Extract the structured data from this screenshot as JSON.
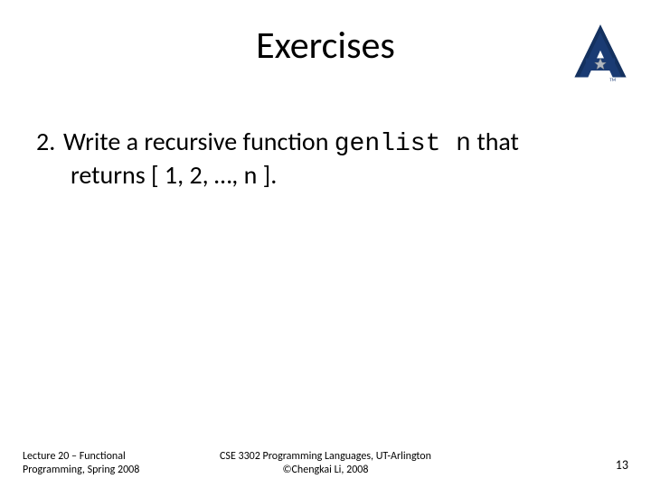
{
  "title": "Exercises",
  "logo": {
    "alt": "UT Arlington A logo",
    "accent_color": "#1a3b73",
    "star_fill": "#b0b7bf"
  },
  "exercise": {
    "number": "2.",
    "prefix": "Write a recursive function ",
    "code": "genlist n",
    "mid": " that",
    "line2": "returns [ 1, 2, …, n ]."
  },
  "footer": {
    "left_line1": "Lecture 20 – Functional",
    "left_line2": "Programming, Spring 2008",
    "center_line1": "CSE 3302 Programming Languages, UT-Arlington",
    "center_line2": "©Chengkai Li, 2008",
    "page": "13"
  }
}
